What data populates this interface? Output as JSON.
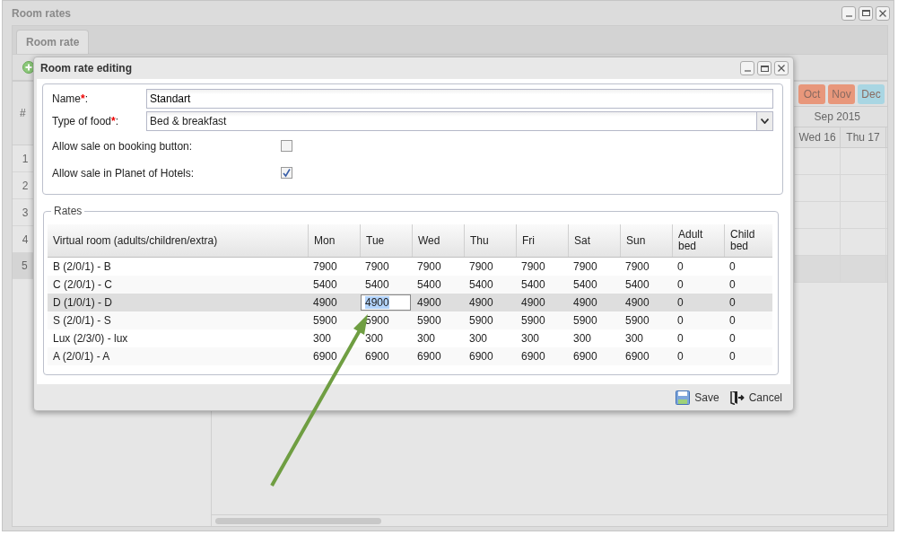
{
  "window": {
    "title": "Room rates"
  },
  "tabs": [
    {
      "label": "Room rate",
      "selected": true
    }
  ],
  "grid": {
    "number_column": "#",
    "rows": [
      {
        "number": "1",
        "selected": false
      },
      {
        "number": "2",
        "selected": false
      },
      {
        "number": "3",
        "selected": false
      },
      {
        "number": "4",
        "selected": false
      },
      {
        "number": "5",
        "selected": true
      }
    ],
    "months": [
      {
        "label": "Oct",
        "color": "#e8977b"
      },
      {
        "label": "Nov",
        "color": "#e8977b"
      },
      {
        "label": "Dec",
        "color": "#a9d6e3"
      }
    ],
    "period": "Sep 2015",
    "days": [
      "Wed 16",
      "Thu 17"
    ]
  },
  "dialog": {
    "title": "Room rate editing",
    "fields": [
      {
        "kind": "text",
        "label": "Name",
        "required_mark": "*",
        "label_end": ":",
        "value": "Standart"
      },
      {
        "kind": "select",
        "label": "Type of food",
        "required_mark": "*",
        "label_end": ":",
        "value": "Bed & breakfast"
      },
      {
        "kind": "checkbox",
        "label": "Allow sale on booking button:",
        "checked": false
      },
      {
        "kind": "checkbox",
        "label": "Allow sale in Planet of Hotels:",
        "checked": true
      }
    ],
    "rates": {
      "legend": "Rates",
      "columns": [
        "Virtual room (adults/children/extra)",
        "Mon",
        "Tue",
        "Wed",
        "Thu",
        "Fri",
        "Sat",
        "Sun",
        "Adult bed",
        "Child bed"
      ],
      "rows": [
        {
          "selected": false,
          "cells": [
            "B (2/0/1) - B",
            "7900",
            "7900",
            "7900",
            "7900",
            "7900",
            "7900",
            "7900",
            "0",
            "0"
          ]
        },
        {
          "selected": false,
          "cells": [
            "C (2/0/1) - C",
            "5400",
            "5400",
            "5400",
            "5400",
            "5400",
            "5400",
            "5400",
            "0",
            "0"
          ]
        },
        {
          "selected": true,
          "cells": [
            "D (1/0/1) - D",
            "4900",
            {
              "value": "4900",
              "editing": true
            },
            "4900",
            "4900",
            "4900",
            "4900",
            "4900",
            "0",
            "0"
          ]
        },
        {
          "selected": false,
          "cells": [
            "S (2/0/1) - S",
            "5900",
            "5900",
            "5900",
            "5900",
            "5900",
            "5900",
            "5900",
            "0",
            "0"
          ]
        },
        {
          "selected": false,
          "cells": [
            "Lux (2/3/0) - lux",
            "300",
            "300",
            "300",
            "300",
            "300",
            "300",
            "300",
            "0",
            "0"
          ]
        },
        {
          "selected": false,
          "cells": [
            "A (2/0/1) - A",
            "6900",
            "6900",
            "6900",
            "6900",
            "6900",
            "6900",
            "6900",
            "0",
            "0"
          ]
        }
      ]
    },
    "buttons": [
      {
        "kind": "save",
        "label": "Save"
      },
      {
        "kind": "cancel",
        "label": "Cancel"
      }
    ]
  }
}
